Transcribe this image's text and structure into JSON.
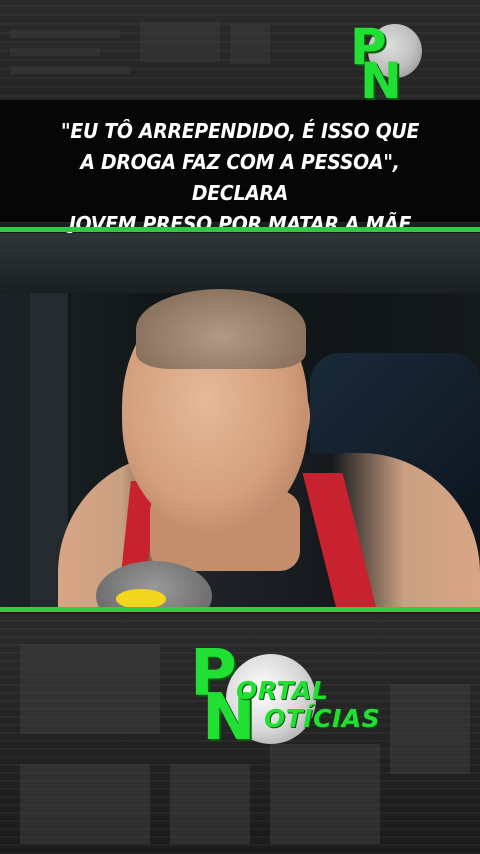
{
  "headline": {
    "line1": "\"EU TÔ ARREPENDIDO, É ISSO QUE",
    "line2": "A DROGA FAZ COM A PESSOA\", DECLARA",
    "line3": "JOVEM PRESO POR MATAR A MÃE"
  },
  "logo_small": {
    "letter_p": "P",
    "letter_n": "N",
    "icon": "globe-icon"
  },
  "logo_big": {
    "letter_p": "P",
    "letter_n": "N",
    "word1": "ORTAL",
    "word2": "OTÍCIAS",
    "icon": "globe-icon"
  },
  "colors": {
    "accent": "#2ecc40",
    "logo_green": "#22e033",
    "strap_red": "#c8222e",
    "mic_badge": "#f3d51d"
  }
}
